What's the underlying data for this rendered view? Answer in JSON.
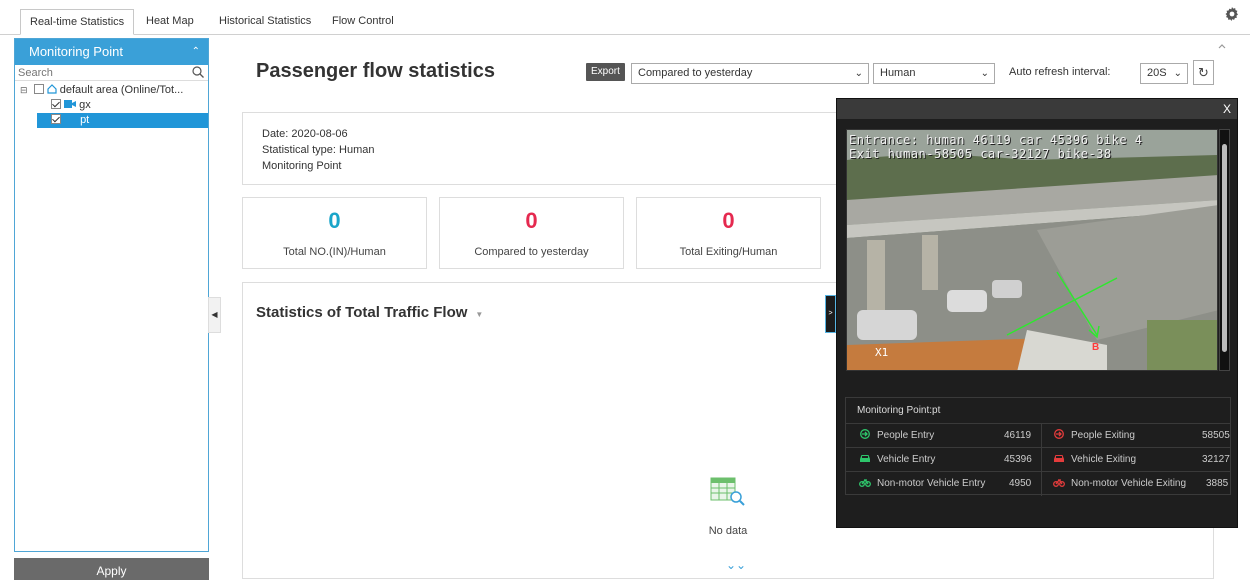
{
  "tabs": [
    {
      "label": "Real-time Statistics",
      "active": true
    },
    {
      "label": "Heat Map"
    },
    {
      "label": "Historical Statistics"
    },
    {
      "label": "Flow Control"
    }
  ],
  "sidebar": {
    "title": "Monitoring Point",
    "search_placeholder": "Search",
    "tree": [
      {
        "label": "default area (Online/Tot...",
        "checked": false,
        "icon": "home-icon"
      },
      {
        "label": "gx",
        "checked": true,
        "icon": "camera-icon"
      },
      {
        "label": "pt",
        "checked": true,
        "selected": true
      }
    ],
    "apply_label": "Apply"
  },
  "header": {
    "title": "Passenger flow statistics",
    "export_label": "Export",
    "compare_select": "Compared to yesterday",
    "type_select": "Human",
    "refresh_label": "Auto refresh interval:",
    "refresh_select": "20S"
  },
  "info": {
    "date": "Date: 2020-08-06",
    "type": "Statistical type: Human",
    "point": "Monitoring Point"
  },
  "stats": [
    {
      "value": "0",
      "label": "Total NO.(IN)/Human",
      "color": "#1aa5c9"
    },
    {
      "value": "0",
      "label": "Compared to yesterday",
      "color": "#e5294f"
    },
    {
      "value": "0",
      "label": "Total Exiting/Human",
      "color": "#e5294f"
    }
  ],
  "flow": {
    "title": "Statistics of Total Traffic Flow",
    "no_data": "No data"
  },
  "popup": {
    "close_label": "X",
    "osd_line1": "Entrance: human 46119 car 45396 bike 4",
    "osd_line2": "Exit     human-58505 car-32127 bike-38",
    "osd_x1": "X1",
    "osd_b": "B",
    "monitoring_point": "Monitoring Point:pt",
    "rows": [
      {
        "left_label": "People Entry",
        "left_value": "46119",
        "left_icon": "entry-arrow-icon",
        "right_label": "People Exiting",
        "right_value": "58505",
        "right_icon": "exit-arrow-icon"
      },
      {
        "left_label": "Vehicle Entry",
        "left_value": "45396",
        "left_icon": "car-icon",
        "right_label": "Vehicle Exiting",
        "right_value": "32127",
        "right_icon": "car-icon"
      },
      {
        "left_label": "Non-motor Vehicle Entry",
        "left_value": "4950",
        "left_icon": "bike-icon",
        "right_label": "Non-motor Vehicle Exiting",
        "right_value": "3885",
        "right_icon": "bike-icon"
      }
    ],
    "entry_color": "#2ec66b",
    "exit_color": "#e43c3c"
  }
}
